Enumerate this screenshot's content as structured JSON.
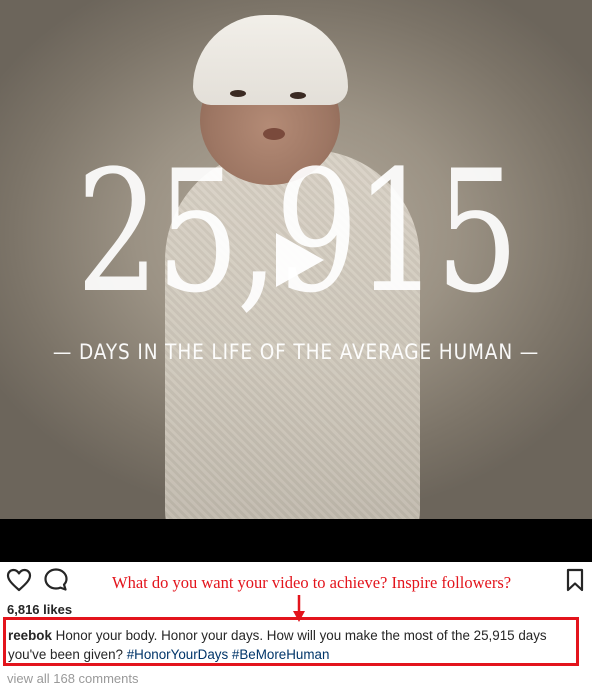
{
  "video": {
    "overlay_number": "25,915",
    "overlay_subtitle": "— DAYS IN THE LIFE OF THE AVERAGE HUMAN —",
    "play_icon": "play-icon"
  },
  "actions": {
    "like_icon": "heart-icon",
    "comment_icon": "comment-bubble-icon",
    "save_icon": "bookmark-icon"
  },
  "annotation": {
    "text": "What do you want your video to achieve? Inspire followers?",
    "color": "#e3141c"
  },
  "post": {
    "likes": "6,816 likes",
    "username": "reebok",
    "caption_text": " Honor your body. Honor your days. How will you make the most of the 25,915 days you've been given? ",
    "hashtags": [
      "#HonorYourDays",
      "#BeMoreHuman"
    ],
    "view_comments": "view all 168 comments"
  },
  "colors": {
    "text": "#262626",
    "hashtag": "#003569",
    "muted": "#999999",
    "highlight": "#e3141c"
  }
}
